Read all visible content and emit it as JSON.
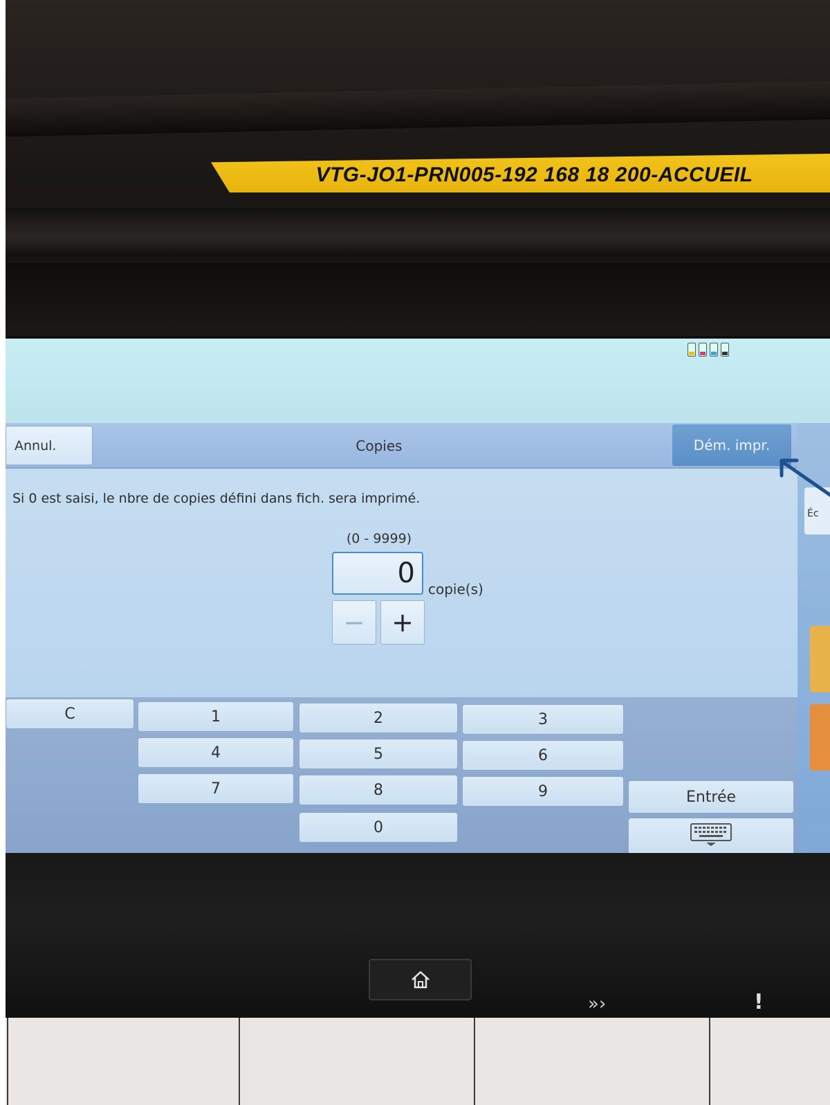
{
  "device_label": "VTG-JO1-PRN005-192 168 18  200-ACCUEIL",
  "header": {
    "cancel_label": "Annul.",
    "title": "Copies",
    "start_print_label": "Dém. impr."
  },
  "content": {
    "info_text": "Si 0 est saisi, le nbre de copies défini dans fich. sera imprimé.",
    "range_text": "(0 - 9999)",
    "copies_value": "0",
    "unit_label": "copie(s)",
    "minus_symbol": "−",
    "plus_symbol": "+"
  },
  "side_tabs": {
    "edit_label": "Éc"
  },
  "keypad": {
    "clear_label": "C",
    "k1": "1",
    "k2": "2",
    "k3": "3",
    "k4": "4",
    "k5": "5",
    "k6": "6",
    "k7": "7",
    "k8": "8",
    "k9": "9",
    "k0": "0",
    "enter_label": "Entrée"
  },
  "icons": {
    "home": "home-icon",
    "keyboard": "keyboard-icon",
    "forward": "forward-icon",
    "alert": "alert-icon",
    "toner": "toner-levels-icon"
  },
  "colors": {
    "accent_button": "#5a8fc8",
    "screen_bg": "#bfe4ee",
    "label_tape": "#f2c41a",
    "annotation_arrow": "#1f4f8f"
  }
}
